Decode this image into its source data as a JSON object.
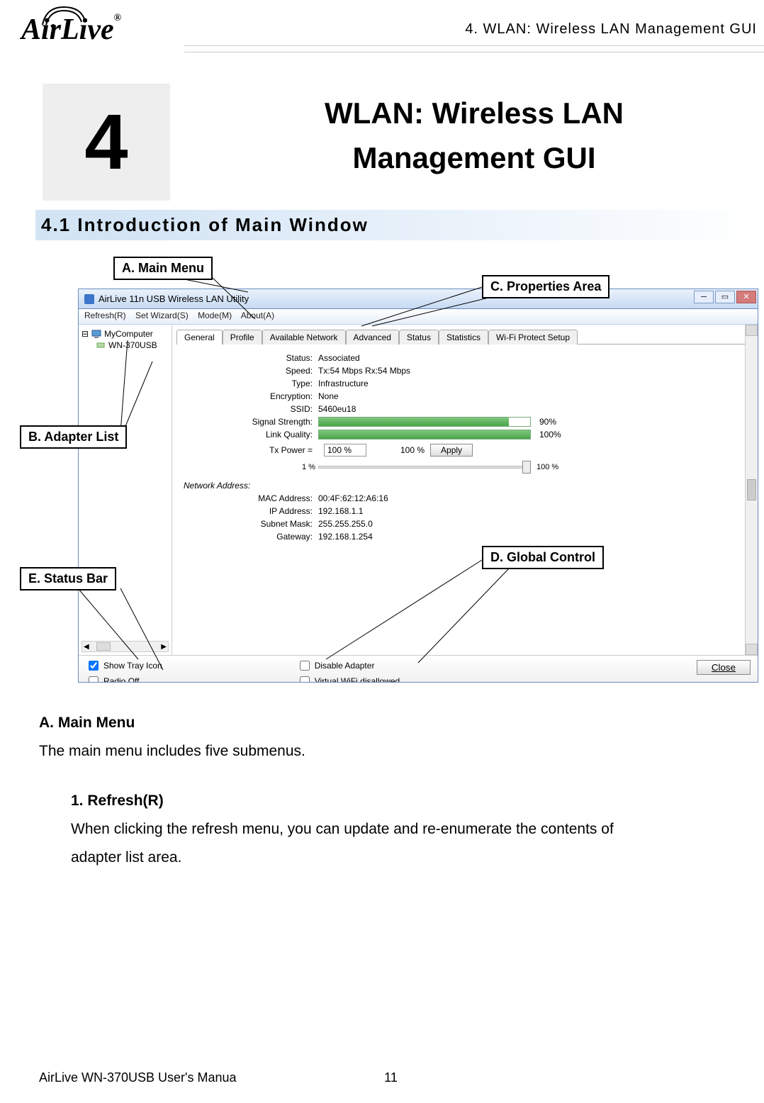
{
  "header_right": "4. WLAN: Wireless LAN Management GUI",
  "logo_text": "AirLive",
  "logo_reg": "®",
  "chapter_num": "4",
  "chapter_title_line1": "WLAN: Wireless LAN",
  "chapter_title_line2": "Management GUI",
  "section_title": "4.1  Introduction  of  Main  Window",
  "callouts": {
    "a": "A. Main Menu",
    "b": "B. Adapter List",
    "c": "C. Properties Area",
    "d": "D. Global Control",
    "e": "E. Status Bar"
  },
  "app": {
    "title": "AirLive 11n USB Wireless LAN Utility",
    "menu": {
      "refresh": "Refresh(R)",
      "wizard": "Set Wizard(S)",
      "mode": "Mode(M)",
      "about": "About(A)"
    },
    "tree": {
      "root": "MyComputer",
      "child": "WN-370USB"
    },
    "tabs": {
      "general": "General",
      "profile": "Profile",
      "available": "Available Network",
      "advanced": "Advanced",
      "status": "Status",
      "statistics": "Statistics",
      "wps": "Wi-Fi Protect Setup"
    },
    "fields": {
      "status_label": "Status:",
      "status_value": "Associated",
      "speed_label": "Speed:",
      "speed_value": "Tx:54 Mbps Rx:54 Mbps",
      "type_label": "Type:",
      "type_value": "Infrastructure",
      "enc_label": "Encryption:",
      "enc_value": "None",
      "ssid_label": "SSID:",
      "ssid_value": "5460eu18",
      "sig_label": "Signal Strength:",
      "sig_pct": "90%",
      "link_label": "Link Quality:",
      "link_pct": "100%",
      "txp_label": "Tx Power =",
      "txp_val": "100 %",
      "txp_display": "100 %",
      "apply": "Apply",
      "slider_lo": "1 %",
      "slider_hi": "100 %",
      "na_label": "Network Address:",
      "mac_label": "MAC Address:",
      "mac_value": "00:4F:62:12:A6:16",
      "ip_label": "IP Address:",
      "ip_value": "192.168.1.1",
      "mask_label": "Subnet Mask:",
      "mask_value": "255.255.255.0",
      "gw_label": "Gateway:",
      "gw_value": "192.168.1.254"
    },
    "bottom": {
      "show_tray": "Show Tray Icon",
      "radio_off": "Radio Off",
      "disable_adapter": "Disable Adapter",
      "virtual_wifi": "Virtual WiFi disallowed",
      "close": "Close"
    }
  },
  "body": {
    "h1": "A. Main Menu",
    "p1": "The main menu includes five submenus.",
    "h2": "1. Refresh(R)",
    "p2a": "When clicking the refresh menu, you can update and re-enumerate the contents of",
    "p2b": "adapter list area."
  },
  "footer": {
    "left": "AirLive WN-370USB User's Manua",
    "page": "11"
  }
}
